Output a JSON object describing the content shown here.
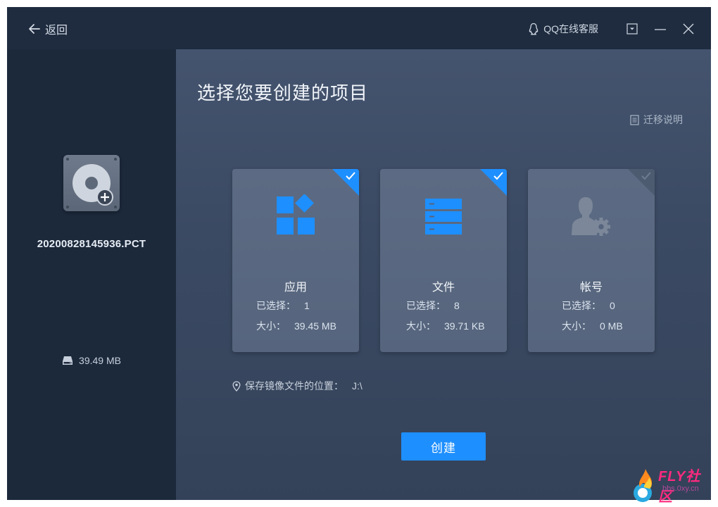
{
  "titlebar": {
    "back_label": "返回",
    "qq_service_label": "QQ在线客服"
  },
  "left_panel": {
    "file_name": "20200828145936.PCT",
    "file_size": "39.49 MB"
  },
  "main": {
    "title": "选择您要创建的项目",
    "migration_help": "迁移说明",
    "cards": [
      {
        "label": "应用",
        "selected_key": "已选择：",
        "selected_value": "1",
        "size_key": "大小：",
        "size_value": "39.45 MB",
        "checked": true
      },
      {
        "label": "文件",
        "selected_key": "已选择：",
        "selected_value": "8",
        "size_key": "大小：",
        "size_value": "39.71 KB",
        "checked": true
      },
      {
        "label": "帐号",
        "selected_key": "已选择：",
        "selected_value": "0",
        "size_key": "大小：",
        "size_value": "0 MB",
        "checked": false
      }
    ],
    "save_location_label": "保存镜像文件的位置：",
    "save_location_value": "J:\\",
    "create_button": "创建"
  },
  "watermark": {
    "text": "FLY社区",
    "sub": "bbs.0xy.cn"
  },
  "colors": {
    "accent": "#1e8fff",
    "titlebar": "#1f2c3f",
    "left_panel": "#1c293b",
    "card": "#5c6b83"
  }
}
